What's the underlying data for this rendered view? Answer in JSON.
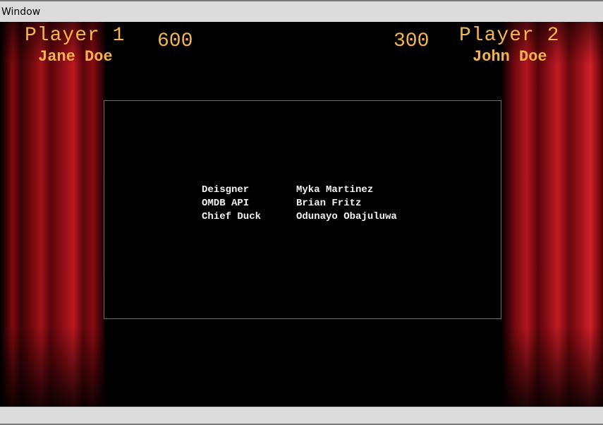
{
  "window": {
    "title": "Window"
  },
  "players": [
    {
      "label": "Player 1",
      "name": "Jane Doe",
      "score": "600"
    },
    {
      "label": "Player 2",
      "name": "John Doe",
      "score": "300"
    }
  ],
  "credits": [
    {
      "role": "Deisgner",
      "person": "Myka Martinez"
    },
    {
      "role": "OMDB API",
      "person": "Brian Fritz"
    },
    {
      "role": "Chief Duck",
      "person": "Odunayo Obajuluwa"
    }
  ],
  "colors": {
    "hud_text": "#f5b54a",
    "curtain_red": "#a0121a",
    "stage_background": "#000000",
    "credits_text": "#f2f2f2"
  }
}
